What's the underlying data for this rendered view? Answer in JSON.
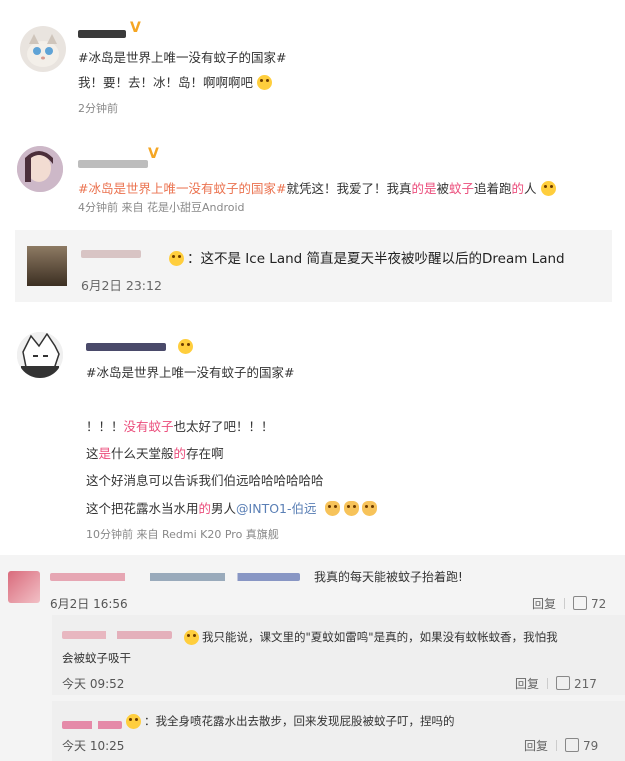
{
  "posts": [
    {
      "topic": "#冰岛是世界上唯一没有蚊子的国家#",
      "text": "我！要！去！冰！岛！啊啊啊吧",
      "time": "2分钟前"
    },
    {
      "topic": "#冰岛是世界上唯一没有蚊子的国家#",
      "text_a": "就凭这！我爱了！我真",
      "text_b": "的是",
      "text_c": "被",
      "text_d": "蚊子",
      "text_e": "追着跑",
      "text_f": "的",
      "text_g": "人",
      "meta": "4分钟前  来自 花是小甜豆Android"
    },
    {
      "comment": "：这不是 Ice Land 简直是夏天半夜被吵醒以后的Dream Land",
      "time": "6月2日 23:12"
    },
    {
      "topic": "#冰岛是世界上唯一没有蚊子的国家#",
      "line1_a": "！！！",
      "line1_b": "没有蚊子",
      "line1_c": "也太好了吧！！！",
      "line2_a": "这",
      "line2_b": "是",
      "line2_c": "什么天堂般",
      "line2_d": "的",
      "line2_e": "存在啊",
      "line3": "这个好消息可以告诉我们伯远哈哈哈哈哈哈",
      "line4_a": "这个把花露水当水用",
      "line4_b": "的",
      "line4_c": "男人",
      "line4_mention": "@INTO1-伯远",
      "meta": "10分钟前  来自 Redmi K20 Pro 真旗舰"
    }
  ],
  "comments": {
    "main": {
      "text": "我真的每天能被蚊子抬着跑!",
      "time": "6月2日 16:56",
      "reply_label": "回复",
      "likes": "72"
    },
    "reply1": {
      "text_a": "我只能说，课文里的\"夏蚊如雷鸣\"是真的，如果没有蚊帐蚊香，我怕我",
      "text_b": "会被蚊子吸干",
      "time": "今天 09:52",
      "reply_label": "回复",
      "likes": "217"
    },
    "reply2": {
      "text": "：我全身喷花露水出去散步，回来发现屁股被蚊子叮，捏吗的",
      "time": "今天 10:25",
      "reply_label": "回复",
      "likes": "79"
    }
  },
  "badges": {
    "v": "V"
  },
  "colors": {
    "topic": "#eb7350",
    "pink": "#eb4e7c",
    "link": "#5a7fb5"
  }
}
